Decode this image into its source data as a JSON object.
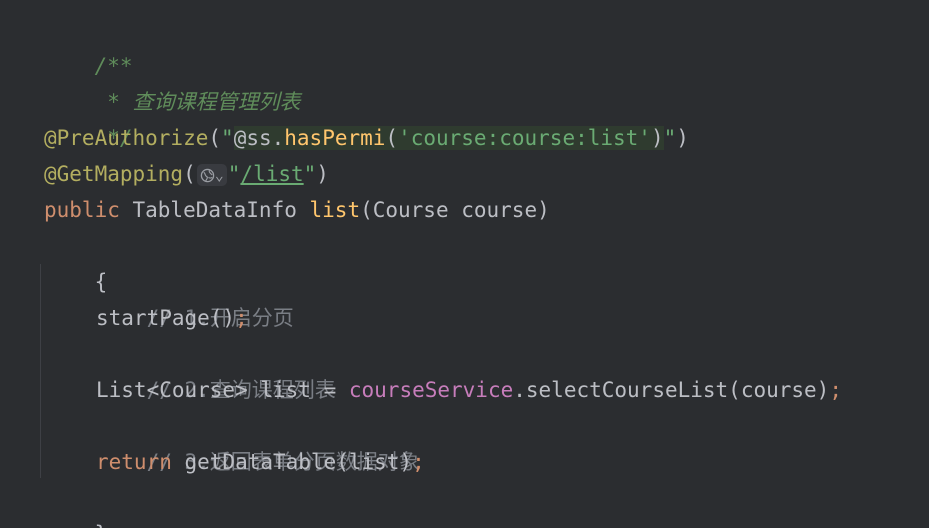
{
  "code": {
    "doc_open": "/**",
    "doc_body": " * 查询课程管理列表",
    "doc_close": " */",
    "preauth_name": "@PreAuthorize",
    "preauth_open": "(",
    "preauth_q1": "\"",
    "preauth_ss": "@ss.",
    "preauth_method": "hasPermi",
    "preauth_paren": "(",
    "preauth_arg": "'course:course:list'",
    "preauth_close_paren": ")",
    "preauth_q2": "\"",
    "preauth_close": ")",
    "getmap_name": "@GetMapping",
    "getmap_open": "(",
    "getmap_chevron": "⌄",
    "getmap_q1": "\"",
    "getmap_url": "/list",
    "getmap_q2": "\"",
    "getmap_close": ")",
    "sig_public": "public",
    "sig_type": " TableDataInfo ",
    "sig_name": "list",
    "sig_params": "(Course course)",
    "brace_open": "{",
    "comment1": "// 1.开启分页",
    "start_page": "startPage()",
    "semi1": ";",
    "comment2": "// 2.查询课程列表",
    "list_decl": "List<Course> list = ",
    "service_field": "courseService",
    "select_call": ".selectCourseList(course)",
    "semi2": ";",
    "comment3": "// 3.返回表单分页数据对象",
    "return_kw": "return",
    "return_call": " getDataTable(list)",
    "semi3": ";",
    "brace_close": "}"
  },
  "icons": {
    "inlay_icon": "globe-icon"
  },
  "colors": {
    "background": "#2b2d30",
    "text": "#bcbec4",
    "doc_comment": "#5f8c5a",
    "line_comment": "#7a7e85",
    "annotation": "#b3ae60",
    "keyword": "#cf8e6d",
    "string": "#6aab73",
    "method": "#56a8f5",
    "field": "#c77dbb"
  }
}
